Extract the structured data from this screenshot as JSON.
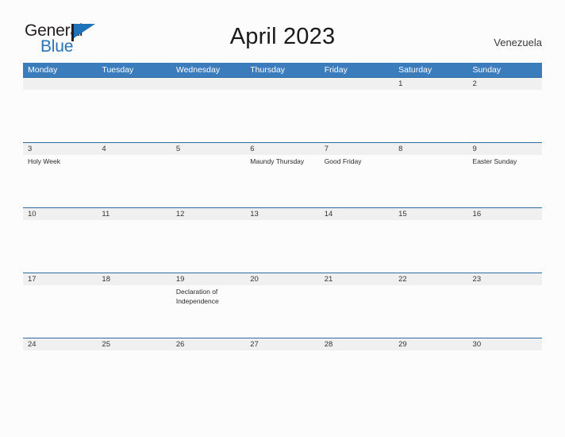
{
  "brand": {
    "name_part1": "General",
    "name_part2": "Blue",
    "flag_icon": "blue-flag-icon",
    "color_dark": "#231f20",
    "color_blue": "#2574bb"
  },
  "header": {
    "title": "April 2023",
    "locale": "Venezuela"
  },
  "calendar": {
    "header_color": "#3b7cbd",
    "date_band_color": "#f0f0f0",
    "separator_color": "#2e6da4",
    "weekdays": [
      "Monday",
      "Tuesday",
      "Wednesday",
      "Thursday",
      "Friday",
      "Saturday",
      "Sunday"
    ],
    "weeks": [
      {
        "days": [
          {
            "date": "",
            "event": ""
          },
          {
            "date": "",
            "event": ""
          },
          {
            "date": "",
            "event": ""
          },
          {
            "date": "",
            "event": ""
          },
          {
            "date": "",
            "event": ""
          },
          {
            "date": "1",
            "event": ""
          },
          {
            "date": "2",
            "event": ""
          }
        ]
      },
      {
        "days": [
          {
            "date": "3",
            "event": "Holy Week"
          },
          {
            "date": "4",
            "event": ""
          },
          {
            "date": "5",
            "event": ""
          },
          {
            "date": "6",
            "event": "Maundy Thursday"
          },
          {
            "date": "7",
            "event": "Good Friday"
          },
          {
            "date": "8",
            "event": ""
          },
          {
            "date": "9",
            "event": "Easter Sunday"
          }
        ]
      },
      {
        "days": [
          {
            "date": "10",
            "event": ""
          },
          {
            "date": "11",
            "event": ""
          },
          {
            "date": "12",
            "event": ""
          },
          {
            "date": "13",
            "event": ""
          },
          {
            "date": "14",
            "event": ""
          },
          {
            "date": "15",
            "event": ""
          },
          {
            "date": "16",
            "event": ""
          }
        ]
      },
      {
        "days": [
          {
            "date": "17",
            "event": ""
          },
          {
            "date": "18",
            "event": ""
          },
          {
            "date": "19",
            "event": "Declaration of Independence"
          },
          {
            "date": "20",
            "event": ""
          },
          {
            "date": "21",
            "event": ""
          },
          {
            "date": "22",
            "event": ""
          },
          {
            "date": "23",
            "event": ""
          }
        ]
      },
      {
        "days": [
          {
            "date": "24",
            "event": ""
          },
          {
            "date": "25",
            "event": ""
          },
          {
            "date": "26",
            "event": ""
          },
          {
            "date": "27",
            "event": ""
          },
          {
            "date": "28",
            "event": ""
          },
          {
            "date": "29",
            "event": ""
          },
          {
            "date": "30",
            "event": ""
          }
        ]
      }
    ]
  }
}
